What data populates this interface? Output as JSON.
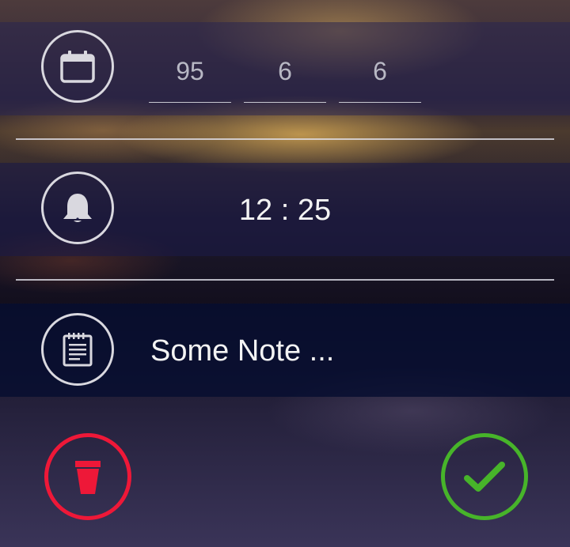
{
  "colors": {
    "icon_outline": "#d9d8df",
    "text": "#f3f3f3",
    "delete": "#ee1838",
    "confirm": "#47b42a"
  },
  "date": {
    "icon": "calendar-icon",
    "fields": [
      "95",
      "6",
      "6"
    ]
  },
  "reminder": {
    "icon": "bell-icon",
    "time": "12 : 25"
  },
  "note": {
    "icon": "notepad-icon",
    "text": "Some Note ..."
  },
  "actions": {
    "delete_icon": "trash-icon",
    "confirm_icon": "checkmark-icon"
  }
}
